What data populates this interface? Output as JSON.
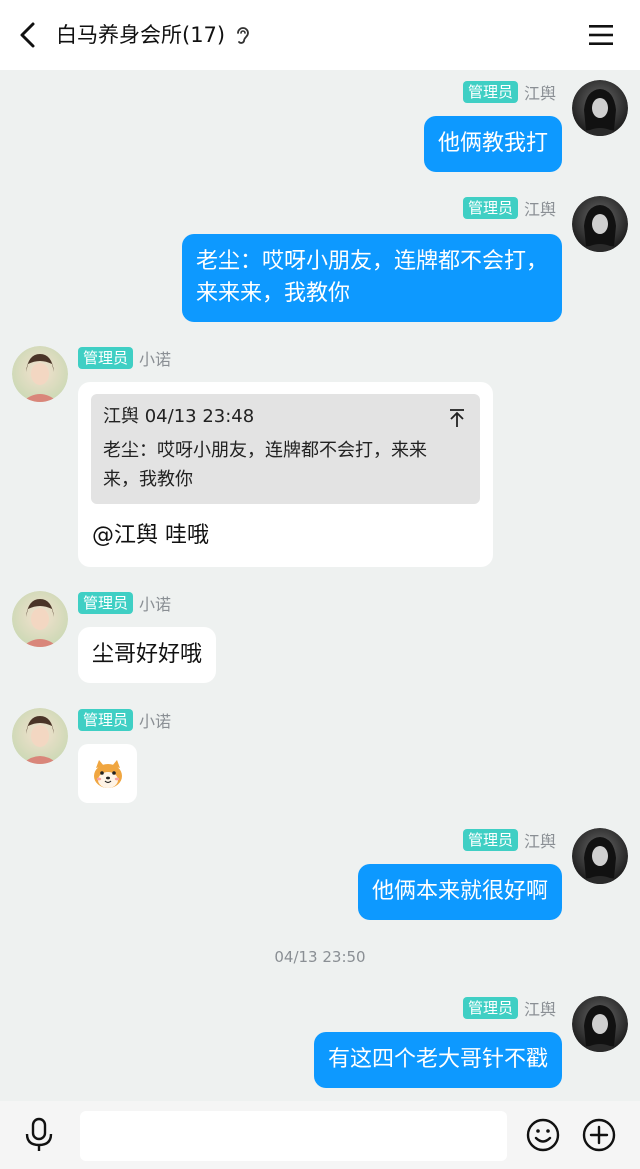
{
  "header": {
    "title": "白马养身会所(17)",
    "back_icon": "chevron-left-icon",
    "ear_icon": "ear-icon",
    "menu_icon": "hamburger-menu-icon"
  },
  "messages": [
    {
      "side": "out",
      "badge": "管理员",
      "sender": "江舆",
      "text": "他俩教我打"
    },
    {
      "side": "out",
      "badge": "管理员",
      "sender": "江舆",
      "text_lines": [
        "老尘：哎呀小朋友，连牌都不会打，",
        "来来来，我教你"
      ]
    },
    {
      "side": "in",
      "badge": "管理员",
      "sender": "小诺",
      "quote": {
        "author_time": "江舆 04/13 23:48",
        "text_lines": [
          "老尘：哎呀小朋友，连牌都不会打，来来",
          "来，我教你"
        ]
      },
      "text": "@江舆 哇哦"
    },
    {
      "side": "in",
      "badge": "管理员",
      "sender": "小诺",
      "text": "尘哥好好哦"
    },
    {
      "side": "in",
      "badge": "管理员",
      "sender": "小诺",
      "sticker": "shiba-dog-sticker"
    },
    {
      "side": "out",
      "badge": "管理员",
      "sender": "江舆",
      "text": "他俩本来就很好啊"
    },
    {
      "side": "out",
      "badge": "管理员",
      "sender": "江舆",
      "text": "有这四个老大哥针不戳"
    }
  ],
  "time_separator": "04/13 23:50",
  "input_bar": {
    "mic_icon": "microphone-icon",
    "input_value": "",
    "emoji_icon": "emoji-icon",
    "plus_icon": "plus-circle-icon"
  },
  "colors": {
    "accent": "#0d99ff",
    "badge": "#3fcfc4",
    "background": "#eef1f0"
  }
}
